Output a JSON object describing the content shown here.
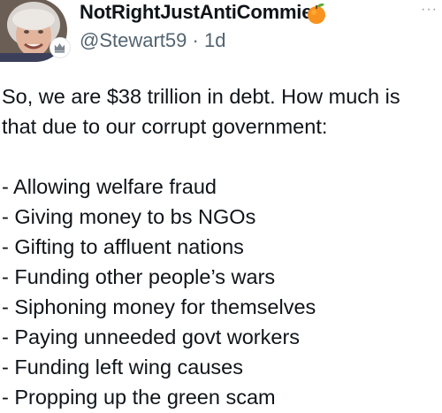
{
  "author": {
    "display_name": "NotRightJustAntiCommie",
    "handle": "@Stewart59",
    "separator": "·",
    "time_ago": "1d",
    "name_emoji": "orange-emoji",
    "badge_icon": "crown-badge-icon",
    "more_label": "···"
  },
  "tweet": {
    "intro_line_1": "So, we are $38 trillion in debt. How much is",
    "intro_line_2": "that due to our corrupt government:",
    "items": [
      "- Allowing welfare fraud",
      "- Giving money to bs NGOs",
      "- Gifting to affluent nations",
      "- Funding other people’s wars",
      "- Siphoning money for themselves",
      "- Paying unneeded govt workers",
      "- Funding left wing causes",
      "- Propping up the green scam"
    ]
  },
  "colors": {
    "text": "#0f1419",
    "secondary_text": "#536471",
    "orange": "#f7931e",
    "leaf": "#5fa832"
  }
}
